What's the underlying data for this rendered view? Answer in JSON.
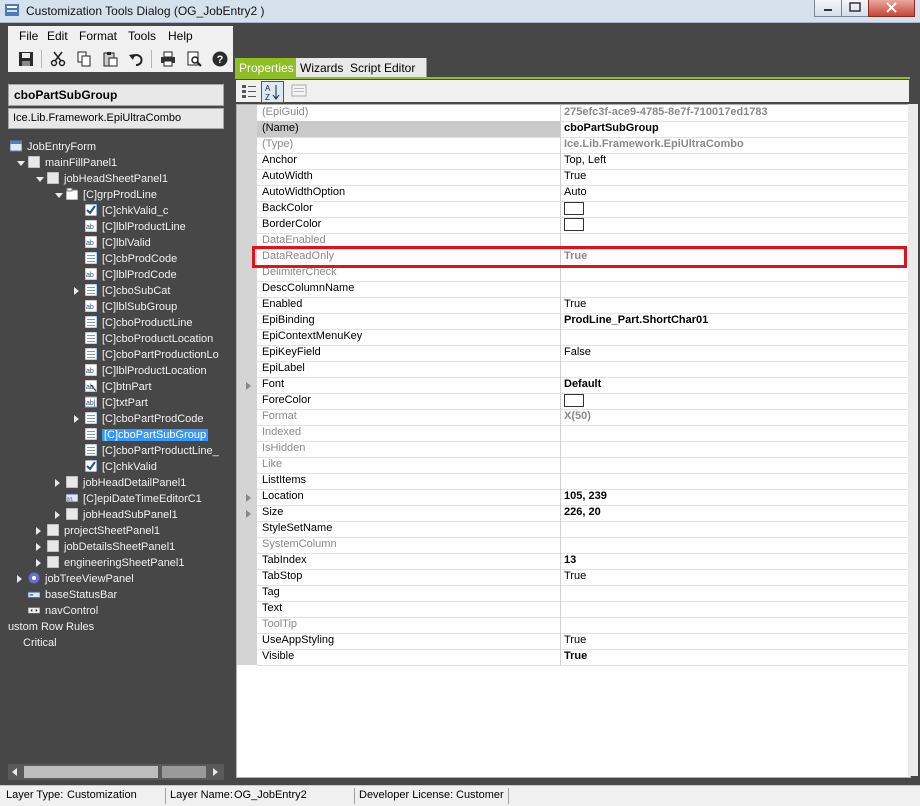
{
  "window": {
    "title": "Customization Tools Dialog  (OG_JobEntry2 )"
  },
  "menu": [
    "File",
    "Edit",
    "Format",
    "Tools",
    "Help"
  ],
  "toolbar": {
    "icons": [
      "save-icon",
      "cut-icon",
      "copy-icon",
      "paste-icon",
      "undo-icon",
      "print-icon",
      "print-preview-icon",
      "help-icon"
    ]
  },
  "selected_object": {
    "name": "cboPartSubGroup",
    "type": "Ice.Lib.Framework.EpiUltraCombo"
  },
  "tree": [
    {
      "label": "JobEntryForm",
      "icon": "form-icon",
      "expander": "none"
    },
    {
      "label": "mainFillPanel1",
      "icon": "panel-icon",
      "expander": "open"
    },
    {
      "label": "jobHeadSheetPanel1",
      "icon": "panel-icon",
      "expander": "open"
    },
    {
      "label": "[C]grpProdLine",
      "icon": "groupbox-icon",
      "expander": "open"
    },
    {
      "label": "[C]chkValid_c",
      "icon": "checkbox-icon",
      "expander": "none"
    },
    {
      "label": "[C]lblProductLine",
      "icon": "label-icon",
      "expander": "none"
    },
    {
      "label": "[C]lblValid",
      "icon": "label-icon",
      "expander": "none"
    },
    {
      "label": "[C]cbProdCode",
      "icon": "combo-icon",
      "expander": "none"
    },
    {
      "label": "[C]lblProdCode",
      "icon": "label-icon",
      "expander": "none"
    },
    {
      "label": "[C]cboSubCat",
      "icon": "combo-icon",
      "expander": "closed"
    },
    {
      "label": "[C]lblSubGroup",
      "icon": "label-icon",
      "expander": "none"
    },
    {
      "label": "[C]cboProductLine",
      "icon": "combo-icon",
      "expander": "none"
    },
    {
      "label": "[C]cboProductLocation",
      "icon": "combo-icon",
      "expander": "none"
    },
    {
      "label": "[C]cboPartProductionLo",
      "icon": "combo-icon",
      "expander": "none"
    },
    {
      "label": "[C]lblProductLocation",
      "icon": "label-icon",
      "expander": "none"
    },
    {
      "label": "[C]btnPart",
      "icon": "button-icon",
      "expander": "none"
    },
    {
      "label": "[C]txtPart",
      "icon": "textbox-icon",
      "expander": "none"
    },
    {
      "label": "[C]cboPartProdCode",
      "icon": "combo-icon",
      "expander": "closed"
    },
    {
      "label": "[C]cboPartSubGroup",
      "icon": "combo-icon",
      "expander": "none",
      "selected": true
    },
    {
      "label": "[C]cboPartProductLine_",
      "icon": "combo-icon",
      "expander": "none"
    },
    {
      "label": "[C]chkValid",
      "icon": "checkbox-icon",
      "expander": "none"
    },
    {
      "label": "jobHeadDetailPanel1",
      "icon": "panel-icon",
      "expander": "closed"
    },
    {
      "label": "[C]epiDateTimeEditorC1",
      "icon": "datetime-icon",
      "expander": "none"
    },
    {
      "label": "jobHeadSubPanel1",
      "icon": "panel-icon",
      "expander": "closed"
    },
    {
      "label": "projectSheetPanel1",
      "icon": "panel-icon",
      "expander": "closed"
    },
    {
      "label": "jobDetailsSheetPanel1",
      "icon": "panel-icon",
      "expander": "closed"
    },
    {
      "label": "engineeringSheetPanel1",
      "icon": "panel-icon",
      "expander": "closed"
    },
    {
      "label": "jobTreeViewPanel",
      "icon": "treeview-icon",
      "expander": "closed"
    },
    {
      "label": "baseStatusBar",
      "icon": "statusbar-icon",
      "expander": "none"
    },
    {
      "label": "navControl",
      "icon": "navcontrol-icon",
      "expander": "none"
    },
    {
      "label": "Custom Row Rules",
      "icon": "none",
      "expander": "none"
    },
    {
      "label": "Critical",
      "icon": "none",
      "expander": "none"
    }
  ],
  "tabs": [
    "Properties",
    "Wizards",
    "Script Editor"
  ],
  "properties": [
    {
      "name": "(EpiGuid)",
      "value": "275efc3f-ace9-4785-8e7f-710017ed1783",
      "style": "gray-bold"
    },
    {
      "name": "(Name)",
      "value": "cboPartSubGroup",
      "style": "selected-bold"
    },
    {
      "name": "(Type)",
      "value": "Ice.Lib.Framework.EpiUltraCombo",
      "style": "gray-bold"
    },
    {
      "name": "Anchor",
      "value": "Top, Left",
      "style": "normal"
    },
    {
      "name": "AutoWidth",
      "value": "True",
      "style": "normal"
    },
    {
      "name": "AutoWidthOption",
      "value": "Auto",
      "style": "normal"
    },
    {
      "name": "BackColor",
      "value": "",
      "style": "color"
    },
    {
      "name": "BorderColor",
      "value": "",
      "style": "color"
    },
    {
      "name": "DataEnabled",
      "value": "",
      "style": "gray"
    },
    {
      "name": "DataReadOnly",
      "value": "True",
      "style": "gray-boldval"
    },
    {
      "name": "DelimiterCheck",
      "value": "",
      "style": "gray"
    },
    {
      "name": "DescColumnName",
      "value": "",
      "style": "normal"
    },
    {
      "name": "Enabled",
      "value": "True",
      "style": "normal"
    },
    {
      "name": "EpiBinding",
      "value": "ProdLine_Part.ShortChar01",
      "style": "bold"
    },
    {
      "name": "EpiContextMenuKey",
      "value": "",
      "style": "normal"
    },
    {
      "name": "EpiKeyField",
      "value": "False",
      "style": "normal"
    },
    {
      "name": "EpiLabel",
      "value": "",
      "style": "normal"
    },
    {
      "name": "Font",
      "value": "Default",
      "style": "bold",
      "expander": true
    },
    {
      "name": "ForeColor",
      "value": "",
      "style": "color"
    },
    {
      "name": "Format",
      "value": "X(50)",
      "style": "gray-boldval"
    },
    {
      "name": "Indexed",
      "value": "",
      "style": "gray"
    },
    {
      "name": "IsHidden",
      "value": "",
      "style": "gray"
    },
    {
      "name": "Like",
      "value": "",
      "style": "gray"
    },
    {
      "name": "ListItems",
      "value": "",
      "style": "normal"
    },
    {
      "name": "Location",
      "value": "105, 239",
      "style": "bold",
      "expander": true
    },
    {
      "name": "Size",
      "value": "226, 20",
      "style": "bold",
      "expander": true
    },
    {
      "name": "StyleSetName",
      "value": "",
      "style": "normal"
    },
    {
      "name": "SystemColumn",
      "value": "",
      "style": "gray"
    },
    {
      "name": "TabIndex",
      "value": "13",
      "style": "bold"
    },
    {
      "name": "TabStop",
      "value": "True",
      "style": "normal"
    },
    {
      "name": "Tag",
      "value": "",
      "style": "normal"
    },
    {
      "name": "Text",
      "value": "",
      "style": "normal"
    },
    {
      "name": "ToolTip",
      "value": "",
      "style": "gray"
    },
    {
      "name": "UseAppStyling",
      "value": "True",
      "style": "normal"
    },
    {
      "name": "Visible",
      "value": "True",
      "style": "bold"
    }
  ],
  "statusbar": {
    "layer_type_label": "Layer Type:",
    "layer_type_value": "Customization",
    "layer_name_label": "Layer Name:",
    "layer_name_value": "OG_JobEntry2",
    "license_label": "Developer License:",
    "license_value": "Customer"
  },
  "colors": {
    "accent_green": "#8fbf24",
    "tree_selection": "#3399ff",
    "highlight_box": "#e0131a",
    "panel_bg": "#474747"
  }
}
